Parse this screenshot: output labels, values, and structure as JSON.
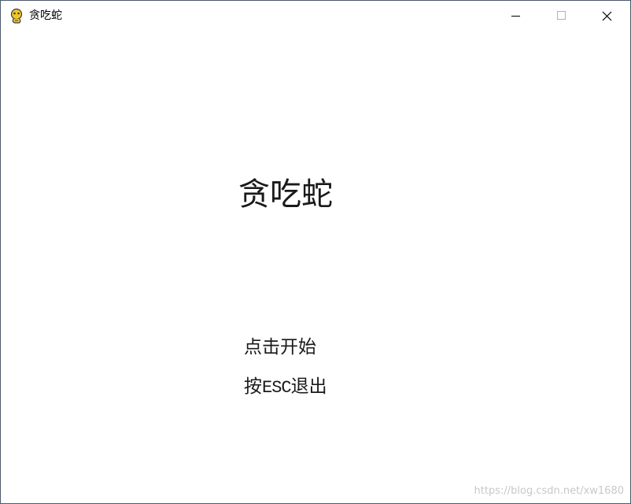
{
  "window": {
    "title": "贪吃蛇",
    "icon": "pygame-snake-icon",
    "controls": {
      "minimize_icon": "minimize-icon",
      "maximize_icon": "maximize-icon",
      "close_icon": "close-icon"
    }
  },
  "screen": {
    "title": "贪吃蛇",
    "start_label": "点击开始",
    "quit_prefix": "按",
    "quit_key": "ESC",
    "quit_suffix": "退出"
  },
  "watermark": "https://blog.csdn.net/xw1680",
  "colors": {
    "background": "#ffffff",
    "text": "#1a1a1a",
    "border": "#4a5a6a",
    "watermark": "#c8c8c8"
  }
}
